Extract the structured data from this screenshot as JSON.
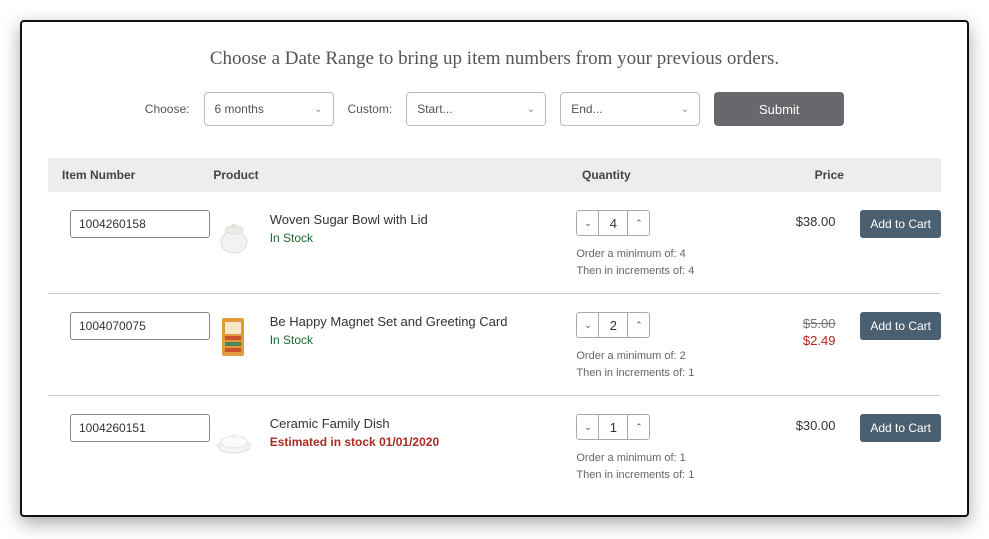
{
  "title": "Choose a Date Range to bring up item numbers from your previous orders.",
  "filters": {
    "choose_label": "Choose:",
    "choose_value": "6 months",
    "custom_label": "Custom:",
    "start_placeholder": "Start...",
    "end_placeholder": "End...",
    "submit_label": "Submit"
  },
  "table": {
    "headers": {
      "item": "Item Number",
      "product": "Product",
      "qty": "Quantity",
      "price": "Price"
    },
    "rows": [
      {
        "item_number": "1004260158",
        "product_name": "Woven Sugar Bowl with Lid",
        "stock_text": "In Stock",
        "stock_status": "in",
        "qty": "4",
        "min_text": "Order a minimum of: 4",
        "inc_text": "Then in increments of: 4",
        "price": "$38.00",
        "sale_price": "",
        "add_label": "Add to Cart",
        "thumb": "bowl"
      },
      {
        "item_number": "1004070075",
        "product_name": "Be Happy Magnet Set and Greeting Card",
        "stock_text": "In Stock",
        "stock_status": "in",
        "qty": "2",
        "min_text": "Order a minimum of: 2",
        "inc_text": "Then in increments of: 1",
        "price": "$5.00",
        "sale_price": "$2.49",
        "add_label": "Add to Cart",
        "thumb": "card"
      },
      {
        "item_number": "1004260151",
        "product_name": "Ceramic Family Dish",
        "stock_text": "Estimated in stock 01/01/2020",
        "stock_status": "est",
        "qty": "1",
        "min_text": "Order a minimum of: 1",
        "inc_text": "Then in increments of: 1",
        "price": "$30.00",
        "sale_price": "",
        "add_label": "Add to Cart",
        "thumb": "dish"
      }
    ]
  }
}
